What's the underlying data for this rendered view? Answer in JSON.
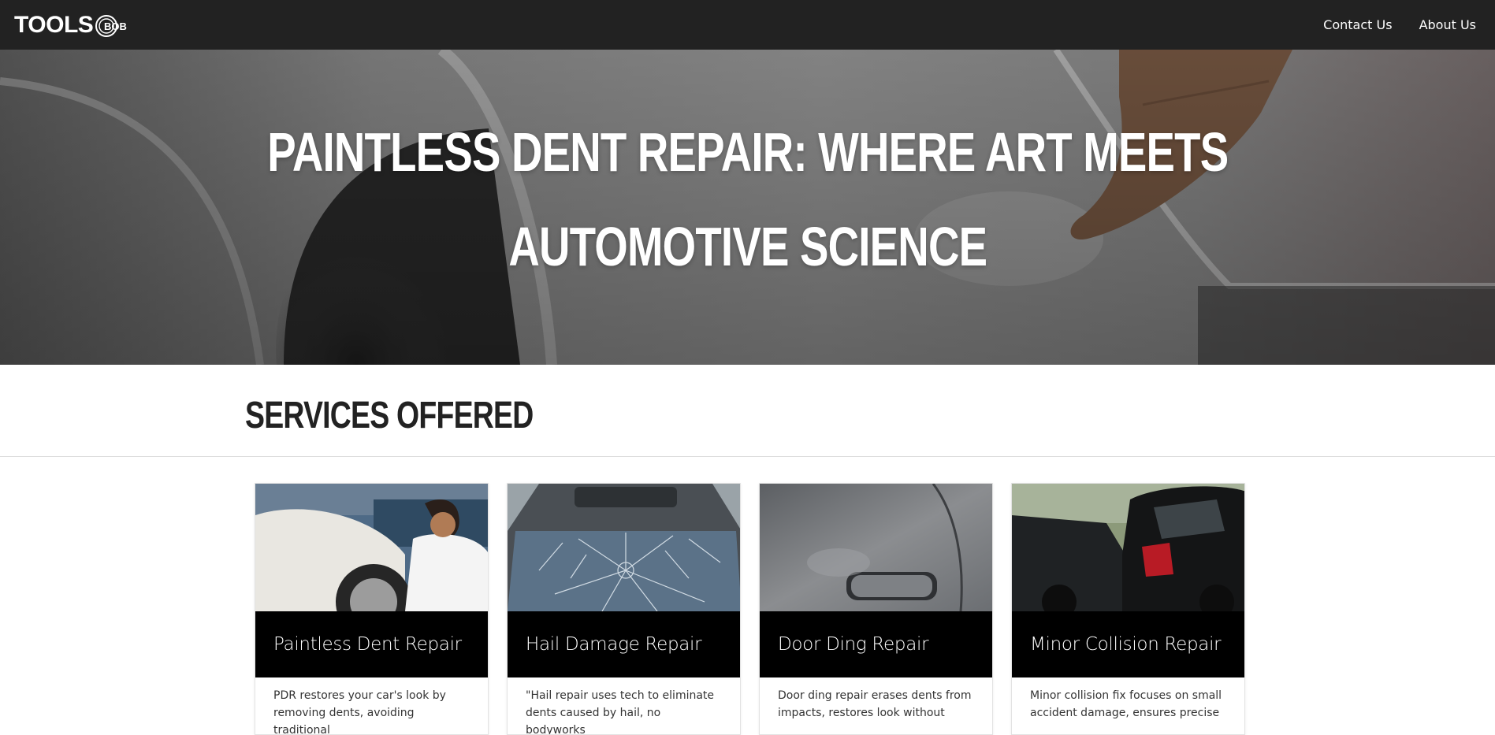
{
  "navbar": {
    "logo_text": "TOOLS",
    "logo_mark_text": "BOB",
    "links": [
      {
        "label": "Contact Us"
      },
      {
        "label": "About Us"
      }
    ]
  },
  "hero": {
    "title_line_1": "PAINTLESS DENT REPAIR: WHERE ART MEETS",
    "title_line_2": "AUTOMOTIVE SCIENCE"
  },
  "services": {
    "title": "SERVICES OFFERED",
    "cards": [
      {
        "title": "Paintless Dent Repair",
        "text": "PDR restores your car's look by removing dents, avoiding traditional",
        "image_icon": "mechanic-at-car-wheel-photo"
      },
      {
        "title": "Hail Damage Repair",
        "text": "\"Hail repair uses tech to eliminate dents caused by hail, no bodyworks",
        "image_icon": "cracked-windshield-photo"
      },
      {
        "title": "Door Ding Repair",
        "text": "Door ding repair erases dents from impacts, restores look without",
        "image_icon": "car-door-handle-photo"
      },
      {
        "title": "Minor Collision Repair",
        "text": "Minor collision fix focuses on small accident damage, ensures precise",
        "image_icon": "rear-end-collision-photo"
      }
    ]
  },
  "colors": {
    "navbar_bg": "#222222",
    "card_title_bg": "#000000",
    "section_title": "#222222"
  }
}
